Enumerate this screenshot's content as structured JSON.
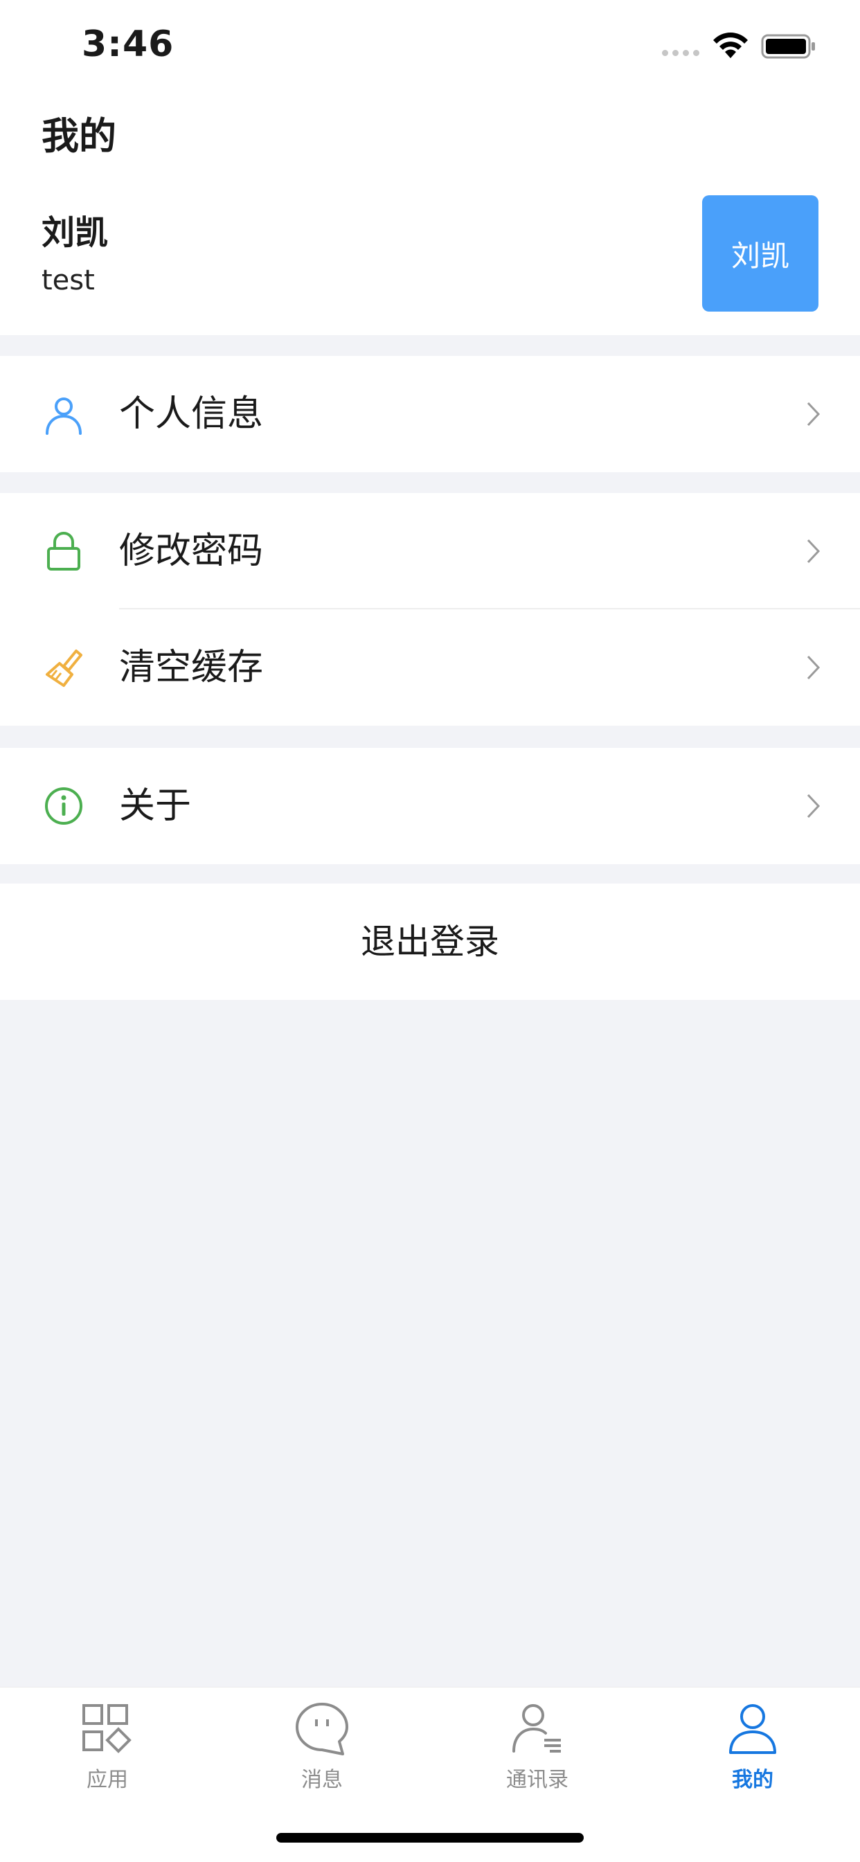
{
  "status_bar": {
    "time": "3:46"
  },
  "header": {
    "title": "我的"
  },
  "profile": {
    "name": "刘凯",
    "account": "test",
    "avatar_text": "刘凯",
    "avatar_color": "#4aa0fa"
  },
  "menu_groups": [
    [
      {
        "label": "个人信息",
        "icon": "user-icon",
        "color": "#4aa0fa"
      }
    ],
    [
      {
        "label": "修改密码",
        "icon": "lock-icon",
        "color": "#4caf50"
      },
      {
        "label": "清空缓存",
        "icon": "brush-icon",
        "color": "#f0b040"
      }
    ],
    [
      {
        "label": "关于",
        "icon": "info-icon",
        "color": "#4caf50"
      }
    ]
  ],
  "logout": {
    "label": "退出登录"
  },
  "tabbar": [
    {
      "label": "应用",
      "icon": "apps-icon",
      "active": false
    },
    {
      "label": "消息",
      "icon": "message-icon",
      "active": false
    },
    {
      "label": "通讯录",
      "icon": "contacts-icon",
      "active": false
    },
    {
      "label": "我的",
      "icon": "profile-icon",
      "active": true
    }
  ],
  "colors": {
    "accent": "#1677e0",
    "background": "#f2f3f7"
  }
}
